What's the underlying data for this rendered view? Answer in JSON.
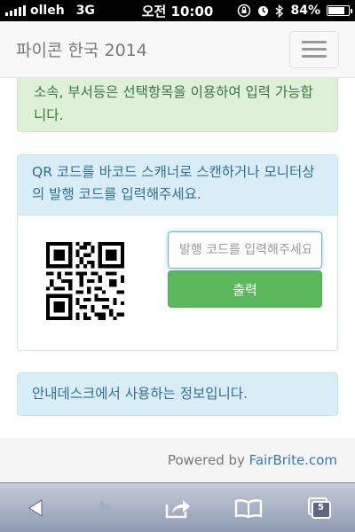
{
  "status_bar": {
    "carrier": "olleh",
    "network": "3G",
    "time": "오전 10:00",
    "battery_percent": "84%",
    "battery_level": 0.84
  },
  "navbar": {
    "brand": "파이콘 한국 2014"
  },
  "alert_success": {
    "text": "소속, 부서등은 선택항목을 이용하여 입력 가능합니다."
  },
  "panel": {
    "heading": "QR 코드를 바코드 스캐너로 스캔하거나 모니터상의 발행 코드를 입력해주세요.",
    "input_placeholder": "발행 코드를 입력해주세요",
    "print_label": "출력"
  },
  "alert_info": {
    "text": "안내데스크에서 사용하는 정보입니다."
  },
  "footer": {
    "powered_by": "Powered by ",
    "link": "FairBrite.com"
  },
  "safari": {
    "tab_count": "5"
  },
  "colors": {
    "success_bg": "#dff0d8",
    "success_text": "#3c763d",
    "info_bg": "#d9edf7",
    "info_text": "#31708f",
    "button_green": "#5cb85c",
    "link_blue": "#337ab7"
  }
}
